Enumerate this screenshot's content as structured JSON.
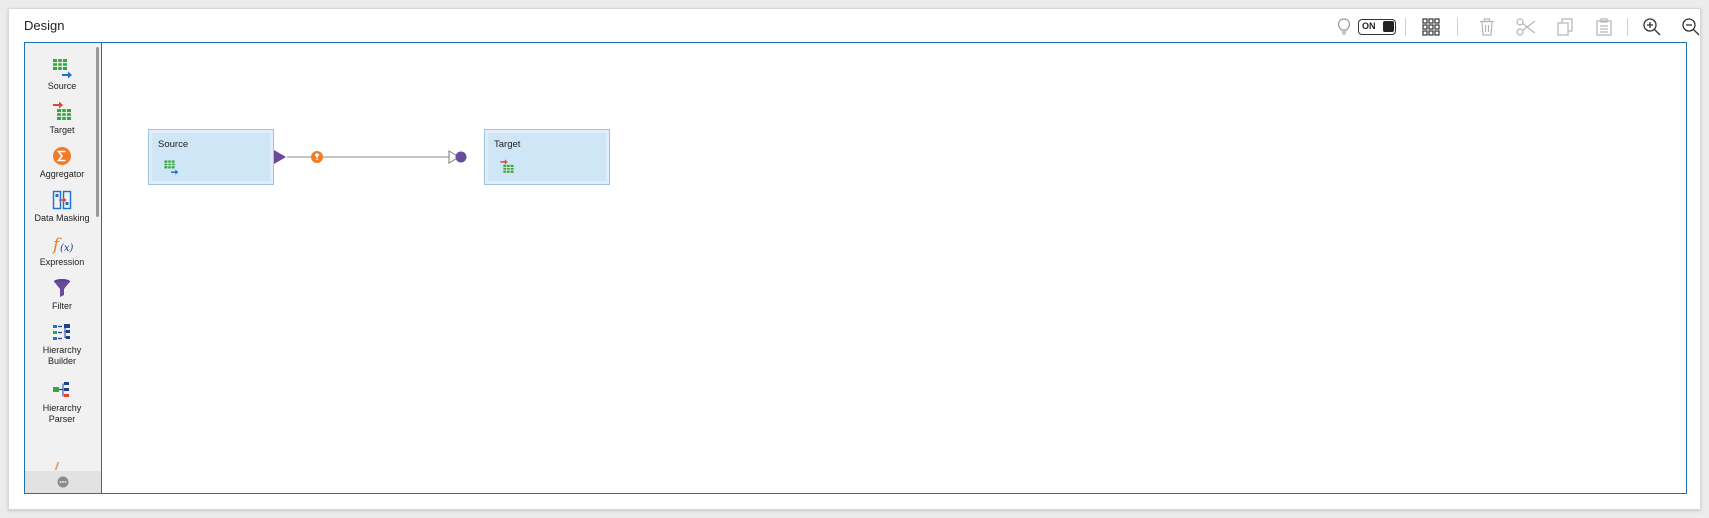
{
  "panel": {
    "title": "Design"
  },
  "toolbar": {
    "toggle_label": "ON",
    "icons": [
      "lightbulb-icon",
      "grid-icon",
      "trash-icon",
      "scissors-icon",
      "copy-icon",
      "paste-icon",
      "zoom-in-icon",
      "zoom-out-icon"
    ]
  },
  "palette": {
    "items": [
      {
        "label": "Source",
        "icon": "source-icon"
      },
      {
        "label": "Target",
        "icon": "target-icon"
      },
      {
        "label": "Aggregator",
        "icon": "aggregator-icon"
      },
      {
        "label": "Data Masking",
        "icon": "data-masking-icon"
      },
      {
        "label": "Expression",
        "icon": "expression-icon"
      },
      {
        "label": "Filter",
        "icon": "filter-icon"
      },
      {
        "label": "Hierarchy Builder",
        "icon": "hierarchy-builder-icon"
      },
      {
        "label": "Hierarchy Parser",
        "icon": "hierarchy-parser-icon"
      }
    ]
  },
  "canvas": {
    "nodes": [
      {
        "label": "Source",
        "icon": "source-icon"
      },
      {
        "label": "Target",
        "icon": "target-icon"
      }
    ],
    "link": {
      "badge_icon": "lightbulb-badge-icon"
    }
  },
  "colors": {
    "accent": "#1f6fb5",
    "node_fill": "#cfe6f7",
    "port": "#6a4a9c",
    "badge": "#f07c28"
  }
}
